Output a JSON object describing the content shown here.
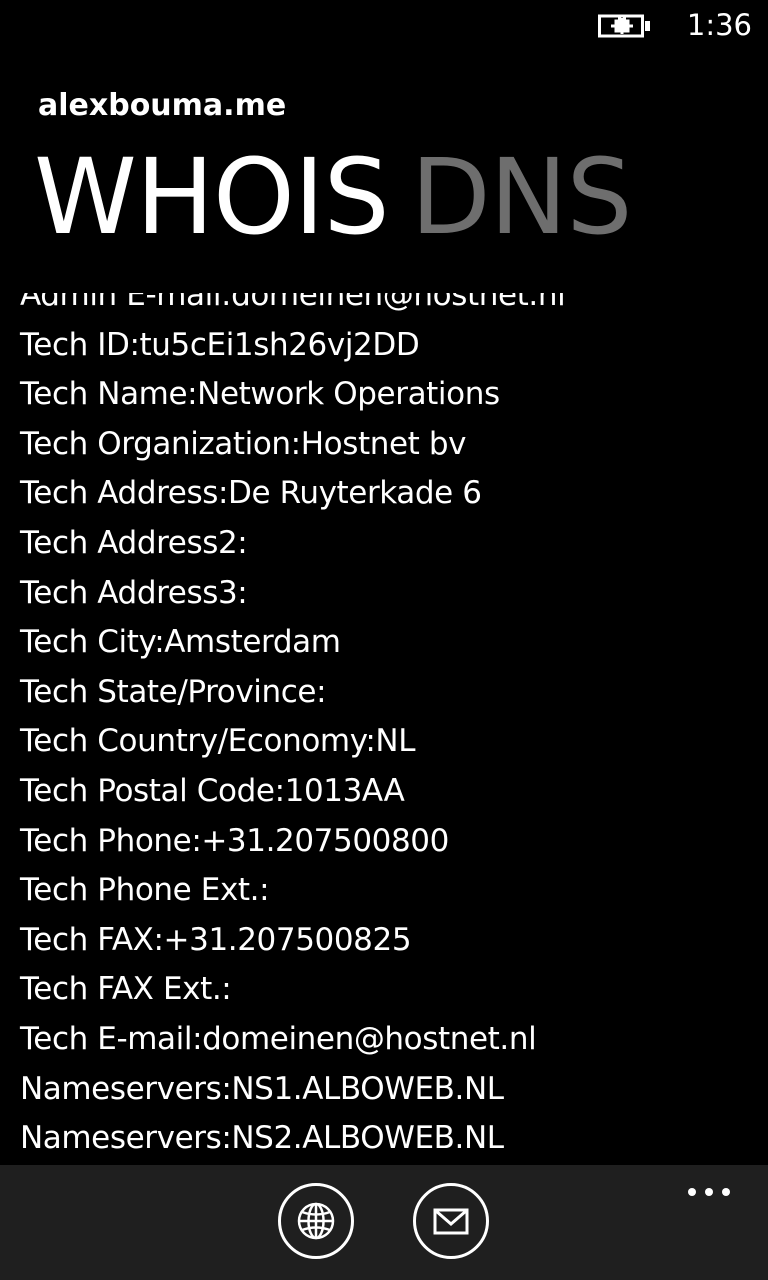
{
  "status_bar": {
    "time": "1:36",
    "battery_icon": "battery-charging-icon"
  },
  "header": {
    "app_name": "alexbouma.me",
    "pivots": [
      {
        "label": "WHOIS",
        "active": true
      },
      {
        "label": "DNS",
        "active": false
      }
    ]
  },
  "record": {
    "lines": [
      "Admin E-mail:domeinen@hostnet.nl",
      "Tech ID:tu5cEi1sh26vj2DD",
      "Tech Name:Network Operations",
      "Tech Organization:Hostnet bv",
      "Tech Address:De Ruyterkade 6",
      "Tech Address2:",
      "Tech Address3:",
      "Tech City:Amsterdam",
      "Tech State/Province:",
      "Tech Country/Economy:NL",
      "Tech Postal Code:1013AA",
      "Tech Phone:+31.207500800",
      "Tech Phone Ext.:",
      "Tech FAX:+31.207500825",
      "Tech FAX Ext.:",
      "Tech E-mail:domeinen@hostnet.nl",
      "Nameservers:NS1.ALBOWEB.NL",
      "Nameservers:NS2.ALBOWEB.NL"
    ]
  },
  "app_bar": {
    "buttons": [
      {
        "icon": "globe-icon"
      },
      {
        "icon": "mail-icon"
      }
    ],
    "more_icon": "more-ellipsis-icon"
  },
  "colors": {
    "background": "#000000",
    "text": "#ffffff",
    "inactive_pivot": "#6e6e6e",
    "app_bar": "#1f1f1f"
  }
}
